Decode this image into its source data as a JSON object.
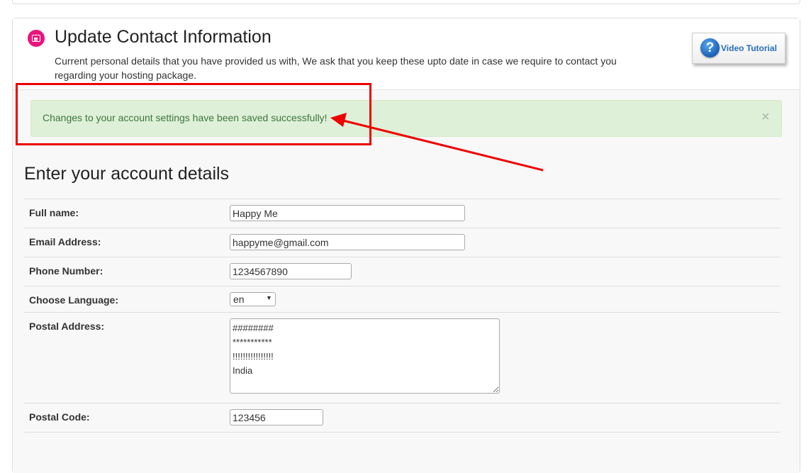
{
  "header": {
    "title": "Update Contact Information",
    "description": "Current personal details that you have provided us with, We ask that you keep these upto date in case we require to contact you regarding your hosting package.",
    "video_tutorial_label": "Video Tutorial"
  },
  "alert": {
    "message": "Changes to your account settings have been saved successfully!",
    "close_glyph": "×"
  },
  "form": {
    "section_title": "Enter your account details",
    "full_name": {
      "label": "Full name:",
      "value": "Happy Me"
    },
    "email": {
      "label": "Email Address:",
      "value": "happyme@gmail.com"
    },
    "phone": {
      "label": "Phone Number:",
      "value": "1234567890"
    },
    "language": {
      "label": "Choose Language:",
      "value": "en"
    },
    "postal_address": {
      "label": "Postal Address:",
      "value": "########\n***********\n!!!!!!!!!!!!!!!!\nIndia"
    },
    "postal_code": {
      "label": "Postal Code:",
      "value": "123456"
    }
  },
  "colors": {
    "accent_icon": "#e8157b",
    "alert_bg": "#dff0d8",
    "alert_text": "#3c763d",
    "annotation": "#ee0000",
    "link": "#2a6ebb"
  },
  "icons": {
    "header": "id-card-icon",
    "video": "question-mark-icon",
    "select": "caret-down-icon"
  }
}
